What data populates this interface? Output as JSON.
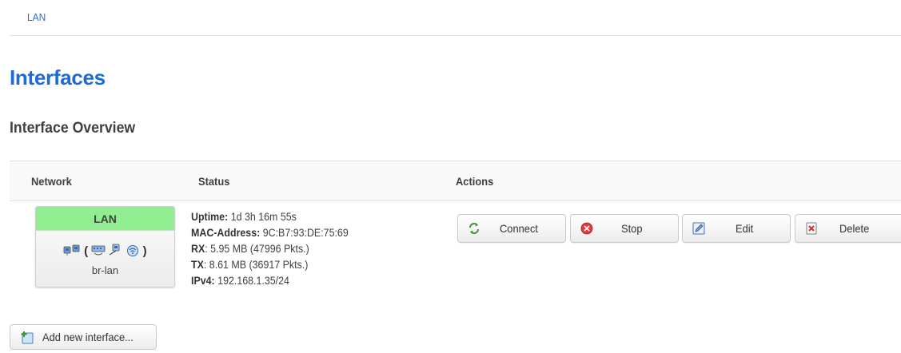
{
  "breadcrumb": {
    "current": "LAN"
  },
  "page": {
    "title": "Interfaces",
    "section_title": "Interface Overview"
  },
  "table": {
    "headers": {
      "network": "Network",
      "status": "Status",
      "actions": "Actions"
    },
    "rows": [
      {
        "network": {
          "name": "LAN",
          "header_color": "#90ee90",
          "icons": [
            "ethernet-port-icon",
            "ethernet-switch-icon",
            "ethernet-adapter-icon",
            "wifi-icon"
          ],
          "open_paren": "(",
          "close_paren": ")",
          "device": "br-lan"
        },
        "status": {
          "uptime_label": "Uptime:",
          "uptime": "1d 3h 16m 55s",
          "mac_label": "MAC-Address:",
          "mac": "9C:B7:93:DE:75:69",
          "rx_label": "RX",
          "rx": ": 5.95 MB (47996 Pkts.)",
          "tx_label": "TX",
          "tx": ": 8.61 MB (36917 Pkts.)",
          "ipv4_label": "IPv4:",
          "ipv4": "192.168.1.35/24"
        },
        "actions": [
          {
            "label": "Connect",
            "icon": "reload-icon"
          },
          {
            "label": "Stop",
            "icon": "stop-icon"
          },
          {
            "label": "Edit",
            "icon": "edit-icon"
          },
          {
            "label": "Delete",
            "icon": "delete-icon"
          }
        ]
      }
    ]
  },
  "add_button": {
    "label": "Add new interface...",
    "icon": "add-icon"
  },
  "colors": {
    "accent": "#1e6ad6",
    "link": "#2a6fd1",
    "network_ok": "#90ee90",
    "stop": "#e23b3b"
  }
}
